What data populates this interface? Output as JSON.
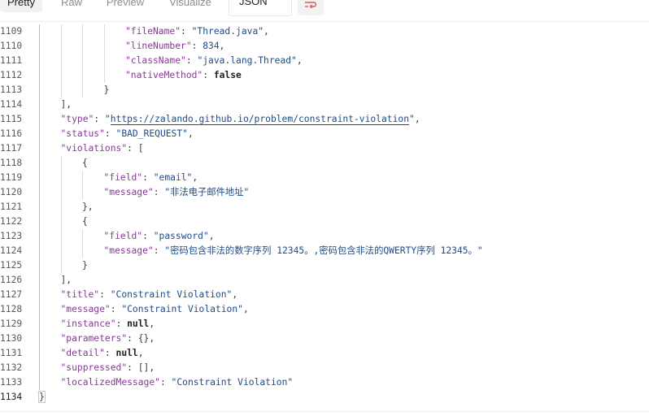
{
  "toolbar": {
    "tabs": [
      "Pretty",
      "Raw",
      "Preview",
      "Visualize"
    ],
    "format_value": "JSON",
    "icons": [
      "chevron-down-icon",
      "wrap-lines-icon"
    ]
  },
  "colors": {
    "key": "#883a96",
    "string": "#1f4b86",
    "wrap_icon": "#e05a4a"
  },
  "code": {
    "lines": [
      {
        "n": "1109",
        "depth": 4,
        "tokens": [
          [
            "k",
            "\"fileName\""
          ],
          [
            "p",
            ": "
          ],
          [
            "s",
            "\"Thread.java\""
          ],
          [
            "p",
            ","
          ]
        ]
      },
      {
        "n": "1110",
        "depth": 4,
        "tokens": [
          [
            "k",
            "\"lineNumber\""
          ],
          [
            "p",
            ": "
          ],
          [
            "n",
            "834"
          ],
          [
            "p",
            ","
          ]
        ]
      },
      {
        "n": "1111",
        "depth": 4,
        "tokens": [
          [
            "k",
            "\"className\""
          ],
          [
            "p",
            ": "
          ],
          [
            "s",
            "\"java.lang.Thread\""
          ],
          [
            "p",
            ","
          ]
        ]
      },
      {
        "n": "1112",
        "depth": 4,
        "tokens": [
          [
            "k",
            "\"nativeMethod\""
          ],
          [
            "p",
            ": "
          ],
          [
            "b",
            "false"
          ]
        ]
      },
      {
        "n": "1113",
        "depth": 3,
        "tokens": [
          [
            "p",
            "}"
          ]
        ]
      },
      {
        "n": "1114",
        "depth": 1,
        "tokens": [
          [
            "p",
            "],"
          ]
        ]
      },
      {
        "n": "1115",
        "depth": 1,
        "tokens": [
          [
            "k",
            "\"type\""
          ],
          [
            "p",
            ": \""
          ],
          [
            "url",
            "https://zalando.github.io/problem/constraint-violation"
          ],
          [
            "s",
            "\""
          ],
          [
            "p",
            ","
          ]
        ]
      },
      {
        "n": "1116",
        "depth": 1,
        "tokens": [
          [
            "k",
            "\"status\""
          ],
          [
            "p",
            ": "
          ],
          [
            "s",
            "\"BAD_REQUEST\""
          ],
          [
            "p",
            ","
          ]
        ]
      },
      {
        "n": "1117",
        "depth": 1,
        "tokens": [
          [
            "k",
            "\"violations\""
          ],
          [
            "p",
            ": ["
          ]
        ]
      },
      {
        "n": "1118",
        "depth": 2,
        "tokens": [
          [
            "p",
            "{"
          ]
        ]
      },
      {
        "n": "1119",
        "depth": 3,
        "tokens": [
          [
            "k",
            "\"field\""
          ],
          [
            "p",
            ": "
          ],
          [
            "s",
            "\"email\""
          ],
          [
            "p",
            ","
          ]
        ]
      },
      {
        "n": "1120",
        "depth": 3,
        "tokens": [
          [
            "k",
            "\"message\""
          ],
          [
            "p",
            ": "
          ],
          [
            "s",
            "\"非法电子邮件地址\""
          ]
        ]
      },
      {
        "n": "1121",
        "depth": 2,
        "tokens": [
          [
            "p",
            "},"
          ]
        ]
      },
      {
        "n": "1122",
        "depth": 2,
        "tokens": [
          [
            "p",
            "{"
          ]
        ]
      },
      {
        "n": "1123",
        "depth": 3,
        "tokens": [
          [
            "k",
            "\"field\""
          ],
          [
            "p",
            ": "
          ],
          [
            "s",
            "\"password\""
          ],
          [
            "p",
            ","
          ]
        ]
      },
      {
        "n": "1124",
        "depth": 3,
        "tokens": [
          [
            "k",
            "\"message\""
          ],
          [
            "p",
            ": "
          ],
          [
            "s",
            "\"密码包含非法的数字序列 12345。,密码包含非法的QWERTY序列 12345。\""
          ]
        ]
      },
      {
        "n": "1125",
        "depth": 2,
        "tokens": [
          [
            "p",
            "}"
          ]
        ]
      },
      {
        "n": "1126",
        "depth": 1,
        "tokens": [
          [
            "p",
            "],"
          ]
        ]
      },
      {
        "n": "1127",
        "depth": 1,
        "tokens": [
          [
            "k",
            "\"title\""
          ],
          [
            "p",
            ": "
          ],
          [
            "s",
            "\"Constraint Violation\""
          ],
          [
            "p",
            ","
          ]
        ]
      },
      {
        "n": "1128",
        "depth": 1,
        "tokens": [
          [
            "k",
            "\"message\""
          ],
          [
            "p",
            ": "
          ],
          [
            "s",
            "\"Constraint Violation\""
          ],
          [
            "p",
            ","
          ]
        ]
      },
      {
        "n": "1129",
        "depth": 1,
        "tokens": [
          [
            "k",
            "\"instance\""
          ],
          [
            "p",
            ": "
          ],
          [
            "b",
            "null"
          ],
          [
            "p",
            ","
          ]
        ]
      },
      {
        "n": "1130",
        "depth": 1,
        "tokens": [
          [
            "k",
            "\"parameters\""
          ],
          [
            "p",
            ": {},"
          ]
        ]
      },
      {
        "n": "1131",
        "depth": 1,
        "tokens": [
          [
            "k",
            "\"detail\""
          ],
          [
            "p",
            ": "
          ],
          [
            "b",
            "null"
          ],
          [
            "p",
            ","
          ]
        ]
      },
      {
        "n": "1132",
        "depth": 1,
        "tokens": [
          [
            "k",
            "\"suppressed\""
          ],
          [
            "p",
            ": [],"
          ]
        ]
      },
      {
        "n": "1133",
        "depth": 1,
        "tokens": [
          [
            "k",
            "\"localizedMessage\""
          ],
          [
            "p",
            ": "
          ],
          [
            "s",
            "\"Constraint Violation\""
          ]
        ]
      },
      {
        "n": "1134",
        "depth": 0,
        "tokens": [
          [
            "p",
            "}"
          ]
        ]
      }
    ]
  }
}
